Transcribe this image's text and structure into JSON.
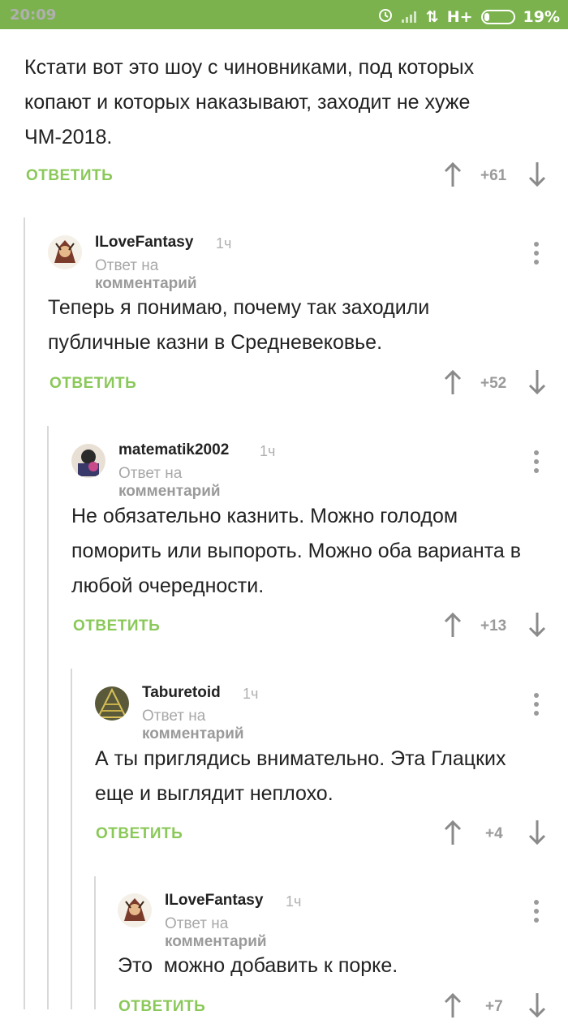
{
  "status_bar": {
    "time": "20:09",
    "network": "H+",
    "battery": "19%",
    "accent_color": "#7bb24d"
  },
  "top_comment": {
    "body": "Кстати вот это шоу с чиновниками, под которых копают и которых наказывают, заходит не хуже ЧМ-2018.",
    "reply_label": "ОТВЕТИТЬ",
    "score": "+61"
  },
  "comments": [
    {
      "author": "ILoveFantasy",
      "time": "1ч",
      "reply_to_prefix": "Ответ на",
      "reply_to_link": "комментарий",
      "body": "Теперь я понимаю, почему так заходили публичные казни в Средневековье.",
      "reply_label": "ОТВЕТИТЬ",
      "score": "+52"
    },
    {
      "author": "matematik2002",
      "time": "1ч",
      "reply_to_prefix": "Ответ на",
      "reply_to_link": "комментарий",
      "body": "Не обязательно казнить. Можно голодом поморить или выпороть. Можно оба варианта в любой очередности.",
      "reply_label": "ОТВЕТИТЬ",
      "score": "+13"
    },
    {
      "author": "Taburetoid",
      "time": "1ч",
      "reply_to_prefix": "Ответ на",
      "reply_to_link": "комментарий",
      "body": "А ты приглядись внимательно. Эта Глацких еще и выглядит неплохо.",
      "reply_label": "ОТВЕТИТЬ",
      "score": "+4"
    },
    {
      "author": "ILoveFantasy",
      "time": "1ч",
      "reply_to_prefix": "Ответ на",
      "reply_to_link": "комментарий",
      "body": "Это  можно добавить к порке.",
      "reply_label": "ОТВЕТИТЬ",
      "score": "+7"
    }
  ]
}
